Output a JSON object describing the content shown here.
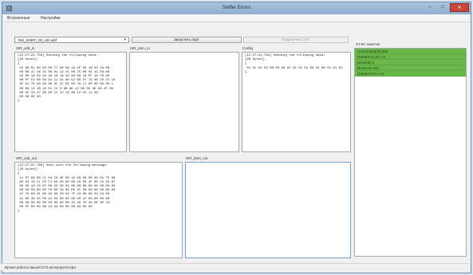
{
  "window": {
    "title": "Sniffer Errors"
  },
  "menu": {
    "items": [
      "Встроенные",
      "Настройки"
    ]
  },
  "toolbar": {
    "port_value": "DM_SNIFF_00_x32.wbf",
    "connect_label": "Запустить порт",
    "disabled_label": "Подключить тест"
  },
  "panels": {
    "isr_usb_in": {
      "label": "ISR_usb_in",
      "text": "[12:27:21.755] Sending the following data:\n[18 bytes]:\n{\n 01 8D 01 00 02 00 77 00 8A 19 0F 00 19 02 1A 08\n 00 00 1C 16 31 00 01 12 15 00 75 00 01 1C 03 00\n 55 00 1A 52 20 20 18 1A 1D 00 00 18 FF 10 7D 30\n 00 FF FD 00 03 02 C1 44 00 52 08 FF 78 00 7D 2C 10\n 3F 51 75 A3 00 00 3C 2C 02 00 7A 17 00 0D 8D 0E 1\n 00 08 14 1B 10 01 C2 3 0B 8E 12 00 00 3D 00 2F 00\n 00 3C 10 27 00 00 12 12 12 00 12 22 11 00\n 00 00 00 00\n}"
    },
    "isr_dom_in": {
      "label": "ISR_dom_in",
      "text": ""
    },
    "config": {
      "label": "Config",
      "text": "[12:27:21.762] Sending the following data:\n[28 bytes]:\n{\n 01 01 01 03 08 00 00 01 01 01 01 00 01 00 01 01 01\n}"
    },
    "isr_usb_out": {
      "label": "ISR_usb_out",
      "text": "[12:27:21.780] Sent with the following message:\n[28 bytes]:\n{\n 11 07 98 00 C1 04 CA 2E 00 1E 00 00 00 00 01 7E 08\n 00 03 10 C1 FE C1 00 00 00 00 19 00 1F 00 15 19 B7\n 00 00 10 13 07 00 20 30 04 00 00 00 00 00 00 00 00\n 00 00 00 00 05 F0 00 16 05 EE 2C 00 00 00 00 00 00\n 4F 73 00 21 00 00 00 20 02 7F 43 00 08 33 24 00\n 41 00 39 45 50 14 00 00 00 00 00 1F 00 00 00 00\n 00 00 00 00 00 00 00 00 00 10 40 7E 46 DE 2E 7A\n 00 FF 08 00 0A 13 2A 00 00 00 00 00 00\n}"
    },
    "isr_dom_out": {
      "label": "ISR_dom_out",
      "text": ""
    }
  },
  "status_panel": {
    "label": "Отчёт пакетов",
    "items": [
      "Connected(ok) 823",
      "Out0Error(ok) 1.0",
      "Error(ok) 2",
      "Reset-ok 212",
      "Out(ok) Error 2.8"
    ]
  },
  "statusbar": {
    "text": "Время работы вашей ST3 интерпретатора"
  }
}
